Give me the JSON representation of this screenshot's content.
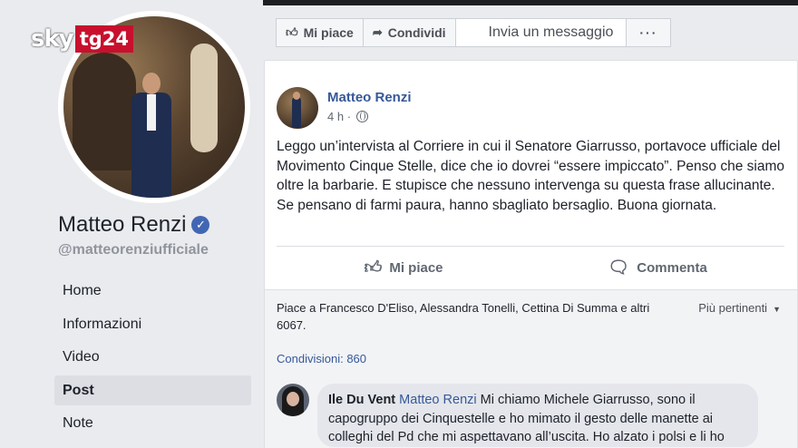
{
  "brand": {
    "sky": "sky",
    "tg": "tg24"
  },
  "page": {
    "name": "Matteo Renzi",
    "handle": "@matteorenziufficiale",
    "verified_icon": "verified-check-icon"
  },
  "nav": {
    "items": [
      "Home",
      "Informazioni",
      "Video",
      "Post",
      "Note"
    ],
    "active_index": 3
  },
  "actions": {
    "like": "Mi piace",
    "share": "Condividi",
    "message": "Invia un messaggio",
    "more": "···"
  },
  "post": {
    "author": "Matteo Renzi",
    "time": "4 h",
    "text": "Leggo un’intervista al Corriere in cui il Senatore Giarrusso, portavoce ufficiale del Movimento Cinque Stelle, dice che io dovrei “essere impiccato”. Penso che siamo oltre la barbarie. E stupisce che nessuno intervenga su questa frase allucinante. Se pensano di farmi paura, hanno sbagliato bersaglio. Buona giornata.",
    "like_label": "Mi piace",
    "comment_label": "Commenta",
    "likes_text": "Piace a Francesco D'Eliso, Alessandra Tonelli, Cettina Di Summa e altri 6067.",
    "sort_label": "Più pertinenti",
    "shares": "Condivisioni: 860"
  },
  "comment": {
    "author": "Ile Du Vent",
    "mention": "Matteo Renzi",
    "text": "Mi chiamo Michele Giarrusso, sono il capogruppo dei Cinquestelle e ho mimato il gesto delle manette ai colleghi del Pd che mi aspettavano all’uscita. Ho alzato i polsi e li ho"
  },
  "colors": {
    "link": "#365899",
    "tg24_red": "#c8102e",
    "background": "#e9ebee"
  }
}
